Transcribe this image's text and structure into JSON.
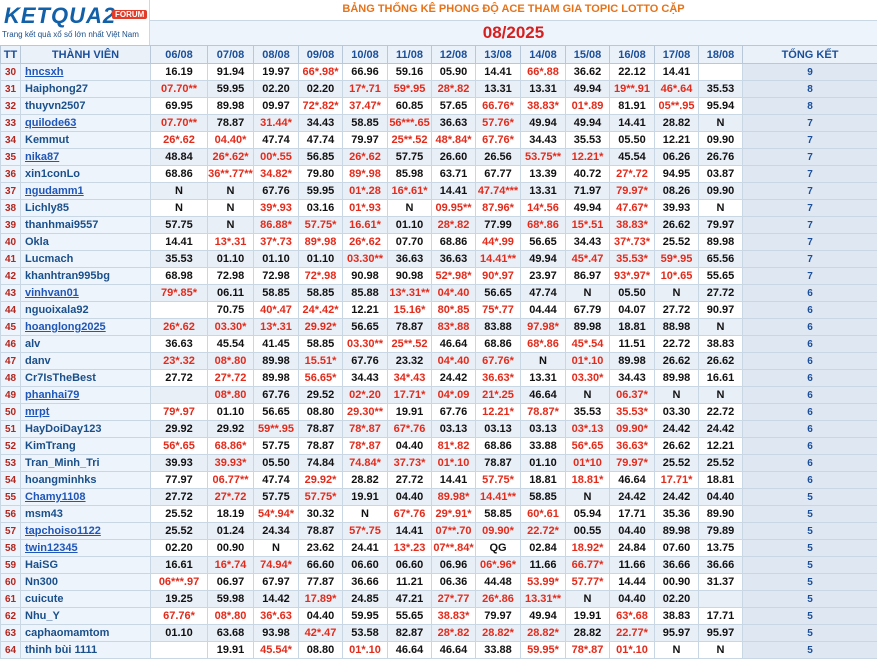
{
  "logo": {
    "brand": "KETQUA2",
    "forum": "FORUM",
    "slogan": "Trang kết quả xổ số lớn nhất Việt Nam"
  },
  "subtitle": "BẢNG THỐNG KÊ PHONG ĐỘ ACE THAM GIA TOPIC LOTTO CẶP",
  "month": "08/2025",
  "headers": [
    "TT",
    "THÀNH VIÊN",
    "06/08",
    "07/08",
    "08/08",
    "09/08",
    "10/08",
    "11/08",
    "12/08",
    "13/08",
    "14/08",
    "15/08",
    "16/08",
    "17/08",
    "18/08",
    "TỔNG KẾT"
  ],
  "rows": [
    {
      "tt": "30",
      "name": "hncsxh",
      "link": true,
      "cells": [
        "16.19",
        "91.94",
        "19.97",
        "66*.98*",
        "66.96",
        "59.16",
        "05.90",
        "14.41",
        "66*.88",
        "36.62",
        "22.12",
        "14.41",
        "",
        ""
      ],
      "total": "9"
    },
    {
      "tt": "31",
      "name": "Haiphong27",
      "link": false,
      "cells": [
        "07.70**",
        "59.95",
        "02.20",
        "02.20",
        "17*.71",
        "59*.95",
        "28*.82",
        "13.31",
        "13.31",
        "49.94",
        "19**.91",
        "46*.64",
        "35.53"
      ],
      "total": "8"
    },
    {
      "tt": "32",
      "name": "thuyvn2507",
      "link": false,
      "cells": [
        "69.95",
        "89.98",
        "09.97",
        "72*.82*",
        "37.47*",
        "60.85",
        "57.65",
        "66.76*",
        "38.83*",
        "01*.89",
        "81.91",
        "05**.95",
        "95.94"
      ],
      "total": "8"
    },
    {
      "tt": "33",
      "name": "quilode63",
      "link": true,
      "cells": [
        "07.70**",
        "78.87",
        "31.44*",
        "34.43",
        "58.85",
        "56***.65",
        "36.63",
        "57.76*",
        "49.94",
        "49.94",
        "14.41",
        "28.82",
        "N"
      ],
      "total": "7"
    },
    {
      "tt": "34",
      "name": "Kemmut",
      "link": false,
      "cells": [
        "26*.62",
        "04.40*",
        "47.74",
        "47.74",
        "79.97",
        "25**.52",
        "48*.84*",
        "67.76*",
        "34.43",
        "35.53",
        "05.50",
        "12.21",
        "09.90"
      ],
      "total": "7"
    },
    {
      "tt": "35",
      "name": "nika87",
      "link": true,
      "cells": [
        "48.84",
        "26*.62*",
        "00*.55",
        "56.85",
        "26*.62",
        "57.75",
        "26.60",
        "26.56",
        "53.75**",
        "12.21*",
        "45.54",
        "06.26",
        "26.76"
      ],
      "total": "7"
    },
    {
      "tt": "36",
      "name": "xin1conLo",
      "link": false,
      "cells": [
        "68.86",
        "36**.77**",
        "34.82*",
        "79.80",
        "89*.98",
        "85.98",
        "63.71",
        "67.77",
        "13.39",
        "40.72",
        "27*.72",
        "94.95",
        "03.87"
      ],
      "total": "7"
    },
    {
      "tt": "37",
      "name": "ngudamm1",
      "link": true,
      "cells": [
        "N",
        "N",
        "67.76",
        "59.95",
        "01*.28",
        "16*.61*",
        "14.41",
        "47.74***",
        "13.31",
        "71.97",
        "79.97*",
        "08.26",
        "09.90"
      ],
      "total": "7"
    },
    {
      "tt": "38",
      "name": "Lichly85",
      "link": false,
      "cells": [
        "N",
        "N",
        "39*.93",
        "03.16",
        "01*.93",
        "N",
        "09.95**",
        "87.96*",
        "14*.56",
        "49.94",
        "47.67*",
        "39.93",
        "N"
      ],
      "total": "7"
    },
    {
      "tt": "39",
      "name": "thanhmai9557",
      "link": false,
      "cells": [
        "57.75",
        "N",
        "86.88*",
        "57.75*",
        "16.61*",
        "01.10",
        "28*.82",
        "77.99",
        "68*.86",
        "15*.51",
        "38.83*",
        "26.62",
        "79.97"
      ],
      "total": "7"
    },
    {
      "tt": "40",
      "name": "Okla",
      "link": false,
      "cells": [
        "14.41",
        "13*.31",
        "37*.73",
        "89*.98",
        "26*.62",
        "07.70",
        "68.86",
        "44*.99",
        "56.65",
        "34.43",
        "37*.73*",
        "25.52",
        "89.98"
      ],
      "total": "7"
    },
    {
      "tt": "41",
      "name": "Lucmach",
      "link": false,
      "cells": [
        "35.53",
        "01.10",
        "01.10",
        "01.10",
        "03.30**",
        "36.63",
        "36.63",
        "14.41**",
        "49.94",
        "45*.47",
        "35.53*",
        "59*.95",
        "65.56"
      ],
      "total": "7"
    },
    {
      "tt": "42",
      "name": "khanhtran995bg",
      "link": false,
      "cells": [
        "68.98",
        "72.98",
        "72.98",
        "72*.98",
        "90.98",
        "90.98",
        "52*.98*",
        "90*.97",
        "23.97",
        "86.97",
        "93*.97*",
        "10*.65",
        "55.65"
      ],
      "total": "7"
    },
    {
      "tt": "43",
      "name": "vinhvan01",
      "link": true,
      "cells": [
        "79*.85*",
        "06.11",
        "58.85",
        "58.85",
        "85.88",
        "13*.31**",
        "04*.40",
        "56.65",
        "47.74",
        "N",
        "05.50",
        "N",
        "27.72"
      ],
      "total": "6"
    },
    {
      "tt": "44",
      "name": "nguoixala92",
      "link": false,
      "cells": [
        "",
        "70.75",
        "40*.47",
        "24*.42*",
        "12.21",
        "15.16*",
        "80*.85",
        "75*.77",
        "04.44",
        "67.79",
        "04.07",
        "27.72",
        "90.97"
      ],
      "total": "6"
    },
    {
      "tt": "45",
      "name": "hoanglong2025",
      "link": true,
      "cells": [
        "26*.62",
        "03.30*",
        "13*.31",
        "29.92*",
        "56.65",
        "78.87",
        "83*.88",
        "83.88",
        "97.98*",
        "89.98",
        "18.81",
        "88.98",
        "N"
      ],
      "total": "6"
    },
    {
      "tt": "46",
      "name": "alv",
      "link": false,
      "cells": [
        "36.63",
        "45.54",
        "41.45",
        "58.85",
        "03.30**",
        "25**.52",
        "46.64",
        "68.86",
        "68*.86",
        "45*.54",
        "11.51",
        "22.72",
        "38.83"
      ],
      "total": "6"
    },
    {
      "tt": "47",
      "name": "danv",
      "link": false,
      "cells": [
        "23*.32",
        "08*.80",
        "89.98",
        "15.51*",
        "67.76",
        "23.32",
        "04*.40",
        "67.76*",
        "N",
        "01*.10",
        "89.98",
        "26.62",
        "26.62"
      ],
      "total": "6"
    },
    {
      "tt": "48",
      "name": "Cr7IsTheBest",
      "link": false,
      "cells": [
        "27.72",
        "27*.72",
        "89.98",
        "56.65*",
        "34.43",
        "34*.43",
        "24.42",
        "36.63*",
        "13.31",
        "03.30*",
        "34.43",
        "89.98",
        "16.61"
      ],
      "total": "6"
    },
    {
      "tt": "49",
      "name": "phanhai79",
      "link": true,
      "cells": [
        "",
        "08*.80",
        "67.76",
        "29.52",
        "02*.20",
        "17.71*",
        "04*.09",
        "21*.25",
        "46.64",
        "N",
        "06.37*",
        "N",
        "N"
      ],
      "total": "6"
    },
    {
      "tt": "50",
      "name": "mrpt",
      "link": true,
      "cells": [
        "79*.97",
        "01.10",
        "56.65",
        "08.80",
        "29.30**",
        "19.91",
        "67.76",
        "12.21*",
        "78.87*",
        "35.53",
        "35.53*",
        "03.30",
        "22.72"
      ],
      "total": "6"
    },
    {
      "tt": "51",
      "name": "HayDoiDay123",
      "link": false,
      "cells": [
        "29.92",
        "29.92",
        "59**.95",
        "78.87",
        "78*.87",
        "67*.76",
        "03.13",
        "03.13",
        "03.13",
        "03*.13",
        "09.90*",
        "24.42",
        "24.42"
      ],
      "total": "6"
    },
    {
      "tt": "52",
      "name": "KimTrang",
      "link": false,
      "cells": [
        "56*.65",
        "68.86*",
        "57.75",
        "78.87",
        "78*.87",
        "04.40",
        "81*.82",
        "68.86",
        "33.88",
        "56*.65",
        "36.63*",
        "26.62",
        "12.21"
      ],
      "total": "6"
    },
    {
      "tt": "53",
      "name": "Tran_Minh_Tri",
      "link": false,
      "cells": [
        "39.93",
        "39.93*",
        "05.50",
        "74.84",
        "74.84*",
        "37.73*",
        "01*.10",
        "78.87",
        "01.10",
        "01*10",
        "79.97*",
        "25.52",
        "25.52"
      ],
      "total": "6"
    },
    {
      "tt": "54",
      "name": "hoangminhks",
      "link": false,
      "cells": [
        "77.97",
        "06.77**",
        "47.74",
        "29.92*",
        "28.82",
        "27.72",
        "14.41",
        "57.75*",
        "18.81",
        "18.81*",
        "46.64",
        "17.71*",
        "18.81"
      ],
      "total": "6"
    },
    {
      "tt": "55",
      "name": "Chamy1108",
      "link": true,
      "cells": [
        "27.72",
        "27*.72",
        "57.75",
        "57.75*",
        "19.91",
        "04.40",
        "89.98*",
        "14.41**",
        "58.85",
        "N",
        "24.42",
        "24.42",
        "04.40"
      ],
      "total": "5"
    },
    {
      "tt": "56",
      "name": "msm43",
      "link": false,
      "cells": [
        "25.52",
        "18.19",
        "54*.94*",
        "30.32",
        "N",
        "67*.76",
        "29*.91*",
        "58.85",
        "60*.61",
        "05.94",
        "17.71",
        "35.36",
        "89.90"
      ],
      "total": "5"
    },
    {
      "tt": "57",
      "name": "tapchoiso1122",
      "link": true,
      "cells": [
        "25.52",
        "01.24",
        "24.34",
        "78.87",
        "57*.75",
        "14.41",
        "07**.70",
        "09.90*",
        "22.72*",
        "00.55",
        "04.40",
        "89.98",
        "79.89"
      ],
      "total": "5"
    },
    {
      "tt": "58",
      "name": "twin12345",
      "link": true,
      "cells": [
        "02.20",
        "00.90",
        "N",
        "23.62",
        "24.41",
        "13*.23",
        "07**.84*",
        "QG",
        "02.84",
        "18.92*",
        "24.84",
        "07.60",
        "13.75"
      ],
      "total": "5"
    },
    {
      "tt": "59",
      "name": "HaiSG",
      "link": false,
      "cells": [
        "16.61",
        "16*.74",
        "74.94*",
        "66.60",
        "06.60",
        "06.60",
        "06.96",
        "06*.96*",
        "11.66",
        "66.77*",
        "11.66",
        "36.66",
        "36.66"
      ],
      "total": "5"
    },
    {
      "tt": "60",
      "name": "Nn300",
      "link": false,
      "cells": [
        "06***.97",
        "06.97",
        "67.97",
        "77.87",
        "36.66",
        "11.21",
        "06.36",
        "44.48",
        "53.99*",
        "57.77*",
        "14.44",
        "00.90",
        "31.37"
      ],
      "total": "5"
    },
    {
      "tt": "61",
      "name": "cuicute",
      "link": false,
      "cells": [
        "19.25",
        "59.98",
        "14.42",
        "17.89*",
        "24.85",
        "47.21",
        "27*.77",
        "26*.86",
        "13.31**",
        "N",
        "04.40",
        "02.20",
        ""
      ],
      "total": "5"
    },
    {
      "tt": "62",
      "name": "Nhu_Y",
      "link": false,
      "cells": [
        "67.76*",
        "08*.80",
        "36*.63",
        "04.40",
        "59.95",
        "55.65",
        "38.83*",
        "79.97",
        "49.94",
        "19.91",
        "63*.68",
        "38.83",
        "17.71"
      ],
      "total": "5"
    },
    {
      "tt": "63",
      "name": "caphaomamtom",
      "link": false,
      "cells": [
        "01.10",
        "63.68",
        "93.98",
        "42*.47",
        "53.58",
        "82.87",
        "28*.82",
        "28.82*",
        "28.82*",
        "28.82",
        "22.77*",
        "95.97",
        "95.97"
      ],
      "total": "5"
    },
    {
      "tt": "64",
      "name": "thinh bùi 1111",
      "link": false,
      "cells": [
        "",
        "19.91",
        "45.54*",
        "08.80",
        "01*.10",
        "46.64",
        "46.64",
        "33.88",
        "59.95*",
        "78*.87",
        "01*.10",
        "N",
        "N"
      ],
      "total": "5"
    }
  ]
}
